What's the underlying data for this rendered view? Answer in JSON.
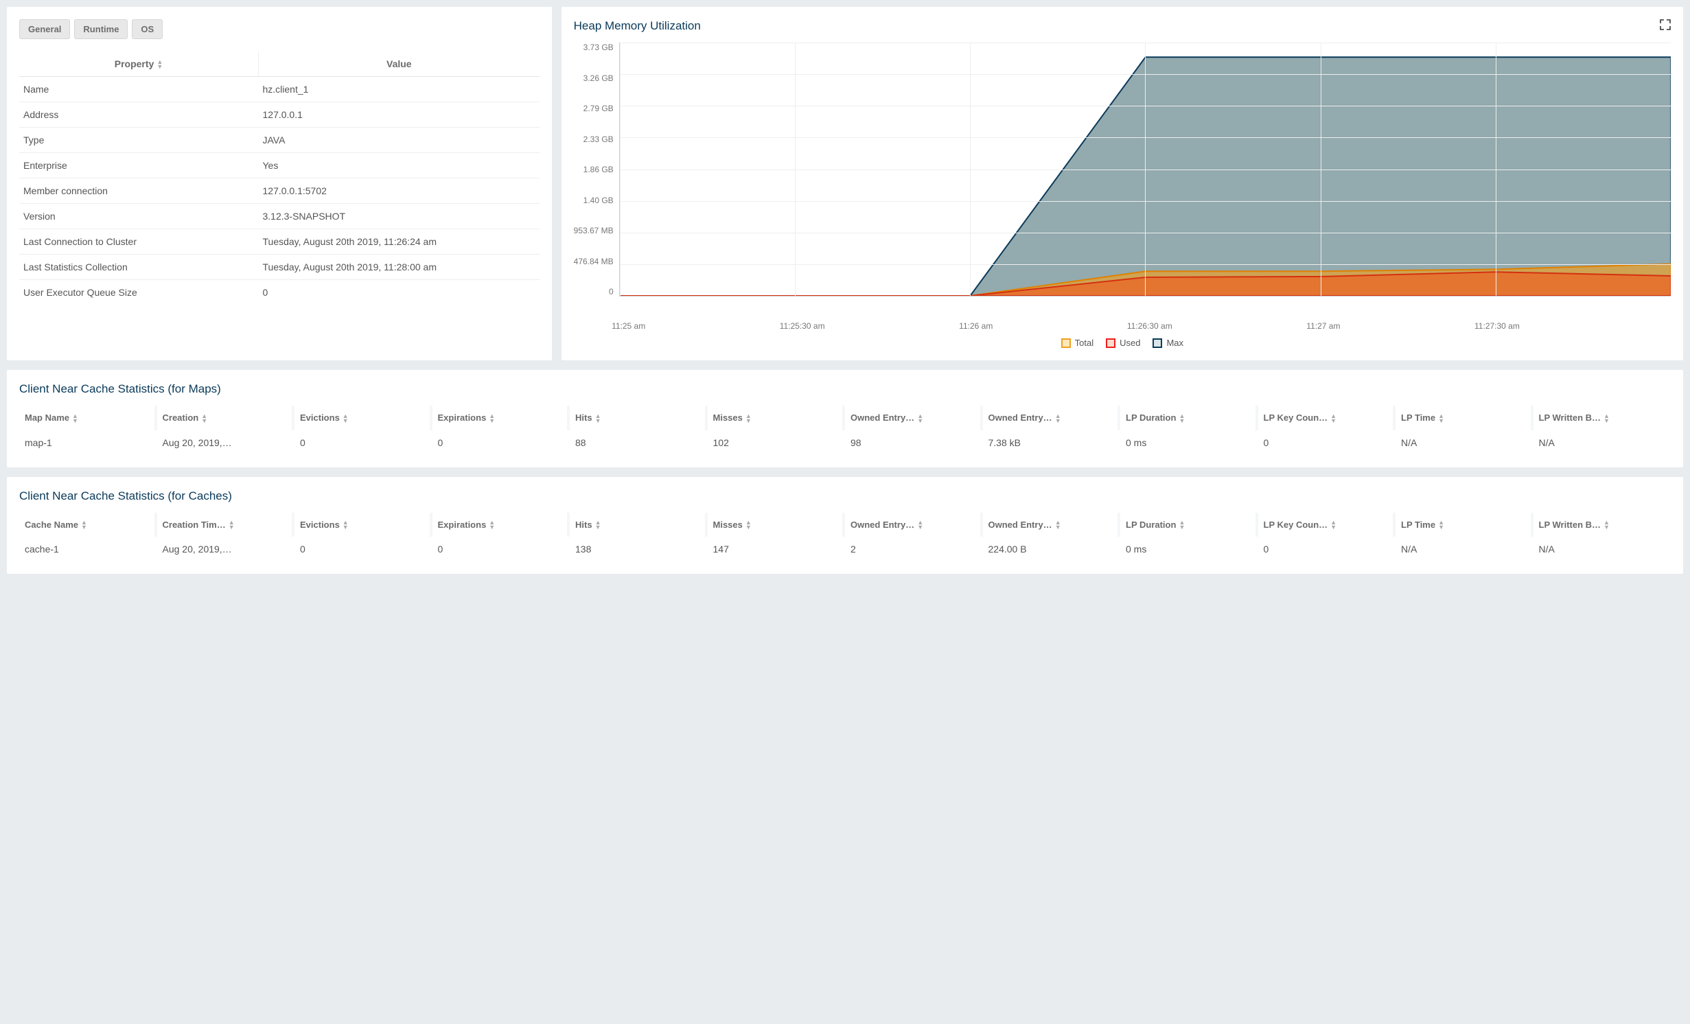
{
  "tabs": {
    "general": "General",
    "runtime": "Runtime",
    "os": "OS"
  },
  "prop_headers": {
    "property": "Property",
    "value": "Value"
  },
  "properties": [
    {
      "label": "Name",
      "value": "hz.client_1"
    },
    {
      "label": "Address",
      "value": "127.0.0.1"
    },
    {
      "label": "Type",
      "value": "JAVA"
    },
    {
      "label": "Enterprise",
      "value": "Yes"
    },
    {
      "label": "Member connection",
      "value": "127.0.0.1:5702"
    },
    {
      "label": "Version",
      "value": "3.12.3-SNAPSHOT"
    },
    {
      "label": "Last Connection to Cluster",
      "value": "Tuesday, August 20th 2019, 11:26:24 am"
    },
    {
      "label": "Last Statistics Collection",
      "value": "Tuesday, August 20th 2019, 11:28:00 am"
    },
    {
      "label": "User Executor Queue Size",
      "value": "0"
    }
  ],
  "chart": {
    "title": "Heap Memory Utilization",
    "legend": {
      "total": "Total",
      "used": "Used",
      "max": "Max"
    }
  },
  "chart_data": {
    "type": "area",
    "title": "Heap Memory Utilization",
    "xlabel": "",
    "ylabel": "",
    "ylim": [
      0,
      3820
    ],
    "y_unit": "MB",
    "y_ticks": [
      "3.73 GB",
      "3.26 GB",
      "2.79 GB",
      "2.33 GB",
      "1.86 GB",
      "1.40 GB",
      "953.67 MB",
      "476.84 MB",
      "0"
    ],
    "x_ticks": [
      "11:25 am",
      "11:25:30 am",
      "11:26 am",
      "11:26:30 am",
      "11:27 am",
      "11:27:30 am"
    ],
    "x_values_sec": [
      0,
      30,
      60,
      90,
      120,
      150,
      180
    ],
    "series": [
      {
        "name": "Max",
        "color": "#6f8d93",
        "values": [
          0,
          0,
          0,
          3600,
          3600,
          3600,
          3600
        ]
      },
      {
        "name": "Total",
        "color": "#f0a020",
        "values": [
          0,
          0,
          0,
          370,
          370,
          400,
          480
        ]
      },
      {
        "name": "Used",
        "color": "#e86d2a",
        "values": [
          0,
          0,
          0,
          280,
          290,
          360,
          300
        ]
      }
    ]
  },
  "maps_section": {
    "title": "Client Near Cache Statistics (for Maps)",
    "headers": [
      "Map Name",
      "Creation",
      "Evictions",
      "Expirations",
      "Hits",
      "Misses",
      "Owned Entry…",
      "Owned Entry…",
      "LP Duration",
      "LP Key Coun…",
      "LP Time",
      "LP Written B…"
    ],
    "rows": [
      [
        "map-1",
        "Aug 20, 2019,…",
        "0",
        "0",
        "88",
        "102",
        "98",
        "7.38 kB",
        "0 ms",
        "0",
        "N/A",
        "N/A"
      ]
    ]
  },
  "caches_section": {
    "title": "Client Near Cache Statistics (for Caches)",
    "headers": [
      "Cache Name",
      "Creation Tim…",
      "Evictions",
      "Expirations",
      "Hits",
      "Misses",
      "Owned Entry…",
      "Owned Entry…",
      "LP Duration",
      "LP Key Coun…",
      "LP Time",
      "LP Written B…"
    ],
    "rows": [
      [
        "cache-1",
        "Aug 20, 2019,…",
        "0",
        "0",
        "138",
        "147",
        "2",
        "224.00 B",
        "0 ms",
        "0",
        "N/A",
        "N/A"
      ]
    ]
  }
}
